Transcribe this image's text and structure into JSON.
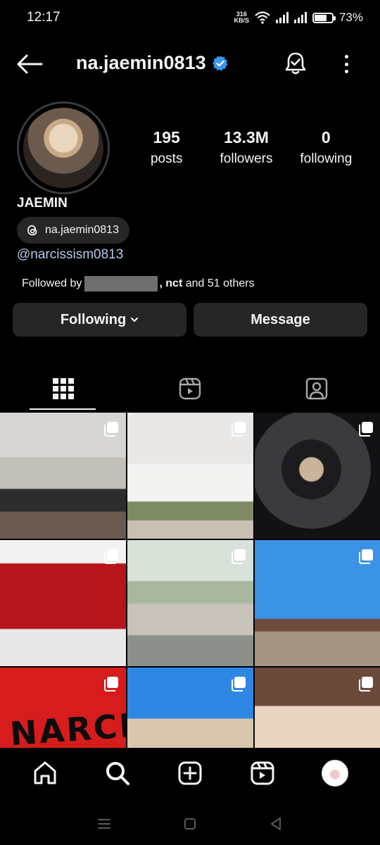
{
  "status_bar": {
    "time": "12:17",
    "net_speed_value": "316",
    "net_speed_unit": "KB/S",
    "battery": "73%",
    "battery_level": 0.73
  },
  "header": {
    "username": "na.jaemin0813",
    "verified": true,
    "icons": [
      "back-arrow-icon",
      "verified-badge-icon",
      "notification-bell-icon",
      "more-options-icon"
    ]
  },
  "profile": {
    "stats": [
      {
        "value": "195",
        "label": "posts"
      },
      {
        "value": "13.3M",
        "label": "followers"
      },
      {
        "value": "0",
        "label": "following"
      }
    ],
    "full_name": "JAEMIN",
    "threads_handle": "na.jaemin0813",
    "link": "@narcissism0813",
    "followed_by": {
      "prefix": "Followed by",
      "name2": ", nct",
      "suffix": "and 51 others"
    }
  },
  "actions": {
    "following_label": "Following",
    "message_label": "Message"
  },
  "tabs": [
    "grid-icon",
    "reels-icon",
    "tagged-icon"
  ],
  "grid_overlay_text": "NARCISSISM",
  "bottom_nav": [
    "home-icon",
    "search-icon",
    "create-icon",
    "reels-icon",
    "profile-avatar"
  ],
  "colors": {
    "background": "#000000",
    "button": "#262626",
    "link": "#b6cbe8",
    "verified": "#3897f0"
  }
}
